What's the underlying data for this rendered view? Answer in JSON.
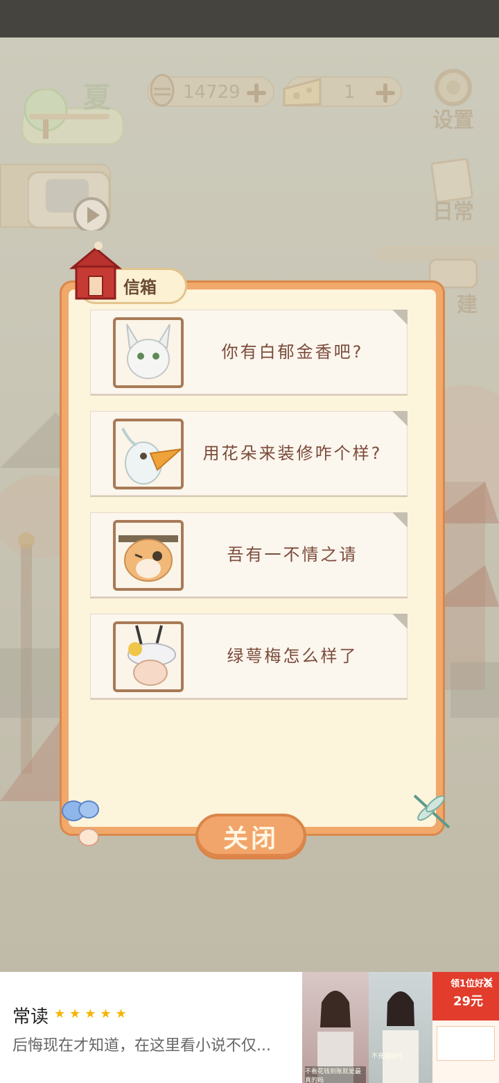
{
  "hud": {
    "season_label": "夏",
    "fish_count": "14729",
    "cheese_count": "1",
    "settings_label": "设置",
    "daily_label": "日常",
    "build_label": "建"
  },
  "mailbox": {
    "title": "信箱",
    "letters": [
      {
        "text": "你有白郁金香吧?",
        "avatar": "white-fox-avatar"
      },
      {
        "text": "用花朵来装修咋个样?",
        "avatar": "white-bird-avatar"
      },
      {
        "text": "吾有一不情之请",
        "avatar": "shiba-dog-avatar"
      },
      {
        "text": "绿萼梅怎么样了",
        "avatar": "antelope-hat-avatar"
      }
    ],
    "close_label": "关闭"
  },
  "ad": {
    "app_name": "常读",
    "stars": "★★★★★",
    "text": "后悔现在才知道，在这里看小说不仅...",
    "thumb1_caption": "不看花钱到账就是最真的吗",
    "thumb2_caption": "不充值送吗",
    "thumb3_title": "领1位好友",
    "thumb3_price": "29元",
    "close_icon": "×"
  },
  "colors": {
    "modal_border": "#f1a86b",
    "panel_bg": "#fdf4dc",
    "text_brown": "#7b4b3a"
  }
}
